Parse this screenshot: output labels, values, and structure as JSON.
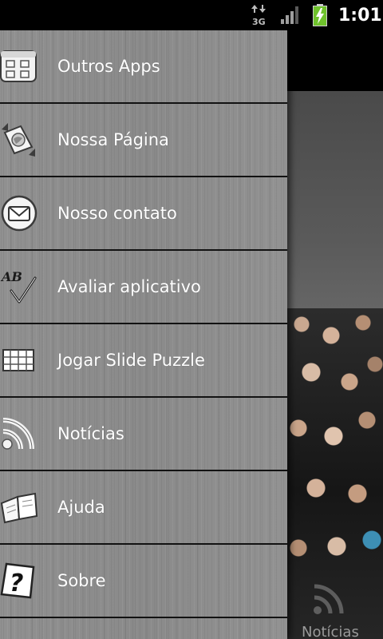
{
  "status_bar": {
    "network": "3G",
    "clock": "1:01",
    "icons": [
      "data-transfer-icon",
      "signal-icon",
      "battery-charging-icon"
    ]
  },
  "drawer": {
    "items": [
      {
        "label": "Outros Apps",
        "icon": "apps-grid-icon"
      },
      {
        "label": "Nossa Página",
        "icon": "globe-page-icon"
      },
      {
        "label": "Nosso contato",
        "icon": "mail-icon"
      },
      {
        "label": "Avaliar aplicativo",
        "icon": "rate-ab-check-icon"
      },
      {
        "label": "Jogar Slide Puzzle",
        "icon": "puzzle-grid-icon"
      },
      {
        "label": "Notícias",
        "icon": "rss-icon"
      },
      {
        "label": "Ajuda",
        "icon": "book-icon"
      },
      {
        "label": "Sobre",
        "icon": "question-icon"
      }
    ]
  },
  "background_app": {
    "tab_label": "Notícias",
    "tab_icon": "rss-icon"
  },
  "colors": {
    "drawer_bg": "#8e8e8e",
    "divider": "#121212",
    "label_text": "#ffffff",
    "battery_green": "#6fc22c"
  }
}
